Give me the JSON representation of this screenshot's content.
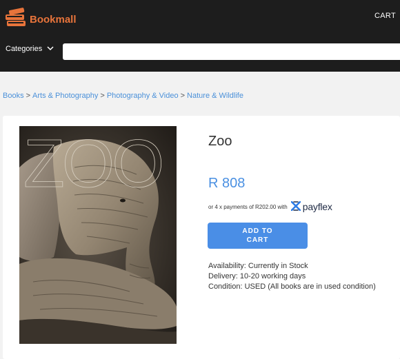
{
  "header": {
    "brand": "Bookmall",
    "cart_label": "CART",
    "categories_label": "Categories",
    "search": {
      "value": "",
      "placeholder": ""
    }
  },
  "breadcrumbs": [
    "Books",
    "Arts & Photography",
    "Photography & Video",
    "Nature & Wildlife"
  ],
  "product": {
    "title": "Zoo",
    "price": "R 808",
    "installments_text": "or 4 x payments of R202.00 with",
    "payflex_label": "payflex",
    "add_to_cart_label": "ADD TO CART",
    "cover_title": "ZOO",
    "availability": "Availability: Currently in Stock",
    "delivery": "Delivery: 10-20 working days",
    "condition": "Condition: USED (All books are in used condition)"
  },
  "colors": {
    "brand": "#e8743b",
    "header_bg": "#1d1d1d",
    "link": "#4a90d9",
    "price": "#4a90e2",
    "button": "#4a8ee6"
  },
  "icons": [
    "books-logo-icon",
    "chevron-down-icon",
    "payflex-logo-icon"
  ]
}
